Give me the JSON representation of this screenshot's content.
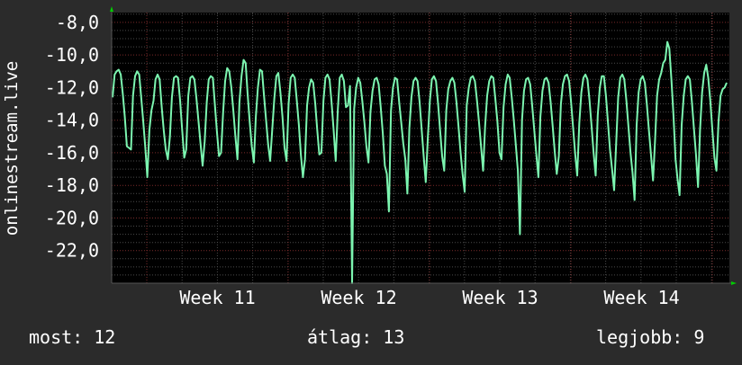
{
  "chart_data": {
    "type": "line",
    "ylabel": "onlinestream.live",
    "ylim": [
      -24,
      -7.4
    ],
    "y_ticks": [
      -8,
      -10,
      -12,
      -14,
      -16,
      -18,
      -20,
      -22
    ],
    "y_tick_labels": [
      "-8,0",
      "-10,0",
      "-12,0",
      "-14,0",
      "-16,0",
      "-18,0",
      "-20,0",
      "-22,0"
    ],
    "x_tick_labels": [
      "Week 11",
      "Week 12",
      "Week 13",
      "Week 14"
    ],
    "grid": true,
    "colors": {
      "background": "#2b2b2b",
      "plot_background": "#000000",
      "grid_major": "#7a2a2a",
      "grid_minor": "#4a4a4a",
      "line": "#7cf5b0",
      "text": "#ffffff",
      "arrow": "#00cc00"
    },
    "series": [
      {
        "values": [
          -12.6,
          -11.2,
          -11.0,
          -10.9,
          -11.2,
          -12.4,
          -13.8,
          -15.6,
          -15.7,
          -15.8,
          -12.5,
          -11.3,
          -11.0,
          -11.2,
          -12.6,
          -14.1,
          -15.7,
          -17.5,
          -14.6,
          -13.4,
          -12.8,
          -11.5,
          -11.2,
          -11.5,
          -13.2,
          -14.6,
          -15.8,
          -16.4,
          -15.0,
          -12.6,
          -11.4,
          -11.3,
          -11.4,
          -12.8,
          -14.6,
          -16.3,
          -15.8,
          -12.5,
          -11.4,
          -11.3,
          -11.5,
          -12.7,
          -14.1,
          -15.5,
          -16.8,
          -15.3,
          -12.9,
          -11.5,
          -11.3,
          -11.4,
          -13.1,
          -14.7,
          -16.2,
          -16.0,
          -13.5,
          -11.6,
          -10.8,
          -11.0,
          -12.0,
          -13.4,
          -15.0,
          -16.4,
          -12.9,
          -11.3,
          -10.3,
          -10.5,
          -12.4,
          -14.1,
          -15.6,
          -16.6,
          -13.8,
          -12.0,
          -10.9,
          -11.0,
          -12.5,
          -14.0,
          -15.5,
          -16.5,
          -14.6,
          -12.7,
          -11.3,
          -11.1,
          -12.3,
          -13.8,
          -15.7,
          -16.5,
          -13.0,
          -11.4,
          -11.2,
          -11.4,
          -12.8,
          -14.3,
          -16.1,
          -17.5,
          -16.4,
          -13.1,
          -12.0,
          -11.5,
          -11.7,
          -13.0,
          -14.6,
          -16.1,
          -16.0,
          -12.8,
          -11.4,
          -11.2,
          -11.5,
          -12.9,
          -14.6,
          -16.5,
          -13.4,
          -11.4,
          -11.2,
          -11.6,
          -13.2,
          -13.1,
          -11.9,
          -24.0,
          -13.3,
          -12.0,
          -11.4,
          -11.7,
          -12.8,
          -14.1,
          -15.6,
          -16.6,
          -13.5,
          -12.2,
          -11.5,
          -11.4,
          -11.8,
          -13.2,
          -14.8,
          -16.8,
          -17.3,
          -19.6,
          -13.4,
          -12.0,
          -11.4,
          -11.5,
          -12.9,
          -14.1,
          -15.4,
          -16.4,
          -18.5,
          -14.5,
          -12.6,
          -11.6,
          -11.4,
          -11.6,
          -12.9,
          -14.6,
          -16.2,
          -17.8,
          -15.1,
          -12.8,
          -11.5,
          -11.3,
          -11.6,
          -13.0,
          -14.6,
          -16.2,
          -17.1,
          -13.4,
          -12.1,
          -11.6,
          -11.4,
          -11.7,
          -12.9,
          -14.4,
          -16.0,
          -17.3,
          -18.4,
          -13.1,
          -12.0,
          -11.4,
          -11.3,
          -11.6,
          -12.8,
          -14.1,
          -15.6,
          -17.1,
          -14.4,
          -12.5,
          -11.6,
          -11.3,
          -11.4,
          -12.7,
          -14.1,
          -16.0,
          -16.4,
          -13.2,
          -11.8,
          -11.2,
          -11.4,
          -12.6,
          -14.0,
          -15.5,
          -17.1,
          -21.0,
          -14.0,
          -12.2,
          -11.5,
          -11.4,
          -11.8,
          -13.1,
          -14.6,
          -16.1,
          -17.5,
          -13.8,
          -12.2,
          -11.5,
          -11.4,
          -11.7,
          -12.9,
          -14.4,
          -15.9,
          -17.3,
          -16.2,
          -13.0,
          -11.8,
          -11.3,
          -11.2,
          -11.6,
          -12.9,
          -14.5,
          -16.1,
          -17.4,
          -14.2,
          -12.3,
          -11.4,
          -11.2,
          -11.5,
          -12.8,
          -14.4,
          -16.0,
          -17.4,
          -13.7,
          -12.0,
          -11.3,
          -11.3,
          -12.5,
          -14.1,
          -15.8,
          -17.0,
          -18.3,
          -15.5,
          -12.6,
          -11.4,
          -11.2,
          -11.5,
          -12.8,
          -14.4,
          -16.0,
          -17.2,
          -18.9,
          -14.3,
          -12.3,
          -11.5,
          -11.3,
          -11.7,
          -13.0,
          -14.6,
          -16.1,
          -17.7,
          -15.3,
          -12.5,
          -11.5,
          -11.1,
          -10.5,
          -10.3,
          -9.2,
          -9.6,
          -11.5,
          -13.7,
          -16.4,
          -17.6,
          -18.6,
          -14.3,
          -12.5,
          -11.5,
          -11.3,
          -11.5,
          -12.9,
          -14.5,
          -16.1,
          -18.1,
          -14.6,
          -12.3,
          -11.1,
          -10.6,
          -11.4,
          -12.8,
          -14.6,
          -16.3,
          -17.1,
          -14.1,
          -12.5,
          -12.1,
          -12.0,
          -11.7
        ]
      }
    ]
  },
  "footer": {
    "current_label": "most: 12",
    "average_label": "átlag: 13",
    "best_label": "legjobb: 9"
  }
}
